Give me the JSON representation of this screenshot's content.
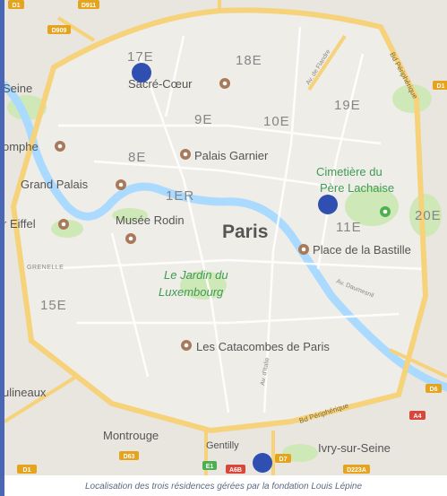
{
  "caption": "Localisation des trois résidences gérées par la fondation Louis Lépine",
  "city_label": "Paris",
  "arrondissements": [
    "17E",
    "18E",
    "19E",
    "9E",
    "10E",
    "8E",
    "1ER",
    "11E",
    "20E",
    "15E"
  ],
  "places": {
    "sacre_coeur": "Sacré-Cœur",
    "seine_left": "Seine",
    "triomphe": "omphe",
    "palais_garnier": "Palais Garnier",
    "grand_palais": "Grand Palais",
    "eiffel": "r Eiffel",
    "musee_rodin": "Musée Rodin",
    "pere_lachaise_1": "Cimetière du",
    "pere_lachaise_2": "Père Lachaise",
    "bastille": "Place de la Bastille",
    "jardin_1": "Le Jardin du",
    "jardin_2": "Luxembourg",
    "grenelle": "GRENELLE",
    "catacombes": "Les Catacombes de Paris",
    "moulineaux": "ulineaux",
    "montrouge": "Montrouge",
    "gentilly": "Gentilly",
    "ivry": "Ivry-sur-Seine"
  },
  "roads": {
    "bd_peripherique_ne": "Bd Périphérique",
    "bd_peripherique_s": "Bd Périphérique",
    "av_flandre": "Av. de Flandre",
    "av_daumesnil": "Av. Daumesnil",
    "av_italie": "Av. d'Italie"
  },
  "shields": {
    "d1": "D1",
    "d909": "D909",
    "d911": "D911",
    "d1_right": "D1",
    "d6": "D6",
    "a4": "A4",
    "d63": "D63",
    "e1": "E1",
    "a6b": "A6B",
    "d7": "D7",
    "d223a": "D223A",
    "d1_left": "D1"
  },
  "markers": [
    "residence-17e",
    "residence-11e",
    "residence-gentilly"
  ],
  "colors": {
    "map_bg": "#efede7",
    "park": "#cfe8b8",
    "water": "#aadaff",
    "boulevard": "#f6d27a",
    "marker": "#2f4fb1",
    "sidebar": "#4a67b6",
    "shield": "#e6a31d",
    "arrondissement_label": "#868686"
  }
}
